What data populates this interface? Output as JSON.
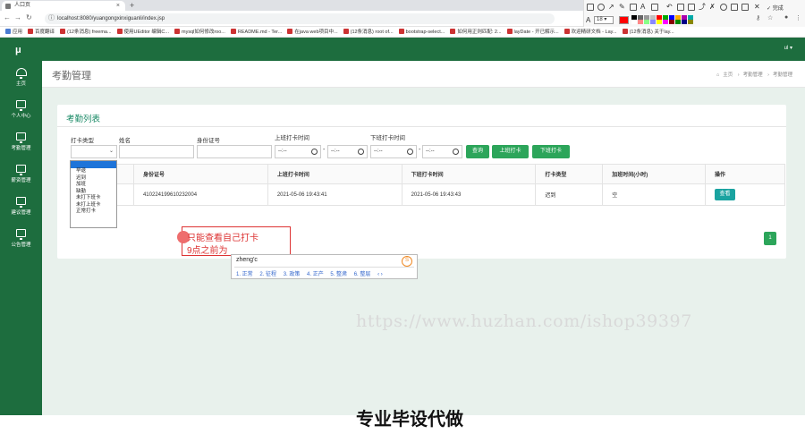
{
  "browser": {
    "tab_title": "人口页",
    "url": "localhost:8080/yuangongxinxiguanli/index.jsp",
    "bookmarks": [
      "应用",
      "百度翻译",
      "(12条消息) freema...",
      "使用UEditor 编辑C...",
      "mysql如何修改roo...",
      "README.md - Ter...",
      "在java web项目中...",
      "(12条消息) root of...",
      "bootstrap-select...",
      "如何用正则匹配: 2...",
      "layDate - 开已解示...",
      "欢迎精研文档 - Lay...",
      "(12条消息) 关于lay..."
    ],
    "toolbar_label": "完成",
    "font_size": "18",
    "palette": [
      "#000000",
      "#666666",
      "#999999",
      "#c0c0c0",
      "#ff0000",
      "#00aa00",
      "#0000ff",
      "#ffaa00",
      "#aa00aa",
      "#00aaaa",
      "#ffffff",
      "#ff8888",
      "#88ff88",
      "#8888ff",
      "#ffff00",
      "#ff00ff",
      "#880000",
      "#008800",
      "#000088",
      "#888800"
    ]
  },
  "app": {
    "logo": "μ",
    "user_menu": "ul ▾",
    "sidebar": [
      {
        "label": "主页",
        "icon": "gauge-icon"
      },
      {
        "label": "个人中心",
        "icon": "monitor-icon"
      },
      {
        "label": "考勤管理",
        "icon": "monitor-icon"
      },
      {
        "label": "薪资管理",
        "icon": "monitor-icon"
      },
      {
        "label": "建议管理",
        "icon": "monitor-icon"
      },
      {
        "label": "公告管理",
        "icon": "monitor-icon"
      }
    ]
  },
  "page": {
    "title": "考勤管理",
    "breadcrumb": [
      "主页",
      "考勤管理",
      "考勤管理"
    ]
  },
  "card": {
    "title": "考勤列表",
    "filters": {
      "type_label": "打卡类型",
      "name_label": "姓名",
      "id_label": "身份证号",
      "in_label": "上班打卡时间",
      "out_label": "下班打卡时间",
      "time_placeholder": "--:--"
    },
    "buttons": {
      "search": "查询",
      "clock_in": "上班打卡",
      "clock_out": "下班打卡"
    },
    "dropdown_options": [
      "早退",
      "迟到",
      "加班",
      "缺勤",
      "未打下班卡",
      "未打上班卡",
      "正常打卡"
    ],
    "table": {
      "headers": [
        "",
        "身份证号",
        "上班打卡时间",
        "下班打卡时间",
        "打卡类型",
        "加班时间(小时)",
        "操作"
      ],
      "rows": [
        {
          "name": "",
          "id": "410224199610232004",
          "in": "2021-05-06 19:43:41",
          "out": "2021-05-06 19:43:43",
          "type": "迟到",
          "overtime": "空",
          "action": "查看"
        }
      ]
    },
    "pager": "1"
  },
  "annotation": {
    "line1": "只能查看自己打卡",
    "line2": "9点之前为"
  },
  "ime": {
    "composition": "zheng'c",
    "candidates": [
      "1. 正常",
      "2. 征程",
      "3. 政策",
      "4. 正产",
      "5. 整肃",
      "6. 整层",
      "‹ ›"
    ],
    "logo": "S"
  },
  "watermark": "https://www.huzhan.com/ishop39397",
  "caption": "专业毕设代做"
}
